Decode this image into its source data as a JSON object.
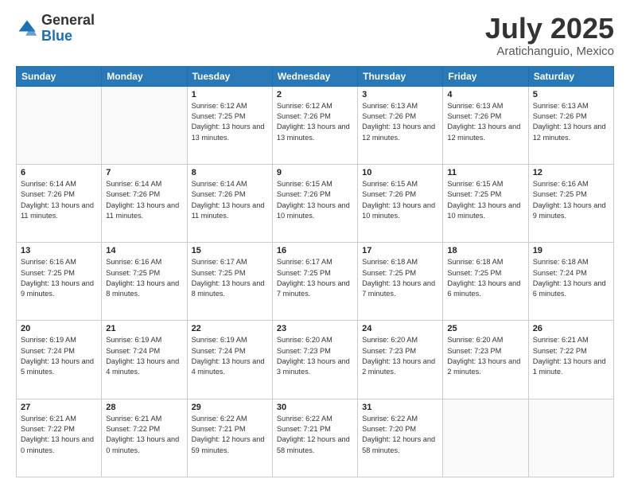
{
  "header": {
    "logo": {
      "general": "General",
      "blue": "Blue"
    },
    "month": "July 2025",
    "location": "Aratichanguio, Mexico"
  },
  "days_of_week": [
    "Sunday",
    "Monday",
    "Tuesday",
    "Wednesday",
    "Thursday",
    "Friday",
    "Saturday"
  ],
  "weeks": [
    [
      {
        "day": "",
        "sunrise": "",
        "sunset": "",
        "daylight": ""
      },
      {
        "day": "",
        "sunrise": "",
        "sunset": "",
        "daylight": ""
      },
      {
        "day": "1",
        "sunrise": "Sunrise: 6:12 AM",
        "sunset": "Sunset: 7:25 PM",
        "daylight": "Daylight: 13 hours and 13 minutes."
      },
      {
        "day": "2",
        "sunrise": "Sunrise: 6:12 AM",
        "sunset": "Sunset: 7:26 PM",
        "daylight": "Daylight: 13 hours and 13 minutes."
      },
      {
        "day": "3",
        "sunrise": "Sunrise: 6:13 AM",
        "sunset": "Sunset: 7:26 PM",
        "daylight": "Daylight: 13 hours and 12 minutes."
      },
      {
        "day": "4",
        "sunrise": "Sunrise: 6:13 AM",
        "sunset": "Sunset: 7:26 PM",
        "daylight": "Daylight: 13 hours and 12 minutes."
      },
      {
        "day": "5",
        "sunrise": "Sunrise: 6:13 AM",
        "sunset": "Sunset: 7:26 PM",
        "daylight": "Daylight: 13 hours and 12 minutes."
      }
    ],
    [
      {
        "day": "6",
        "sunrise": "Sunrise: 6:14 AM",
        "sunset": "Sunset: 7:26 PM",
        "daylight": "Daylight: 13 hours and 11 minutes."
      },
      {
        "day": "7",
        "sunrise": "Sunrise: 6:14 AM",
        "sunset": "Sunset: 7:26 PM",
        "daylight": "Daylight: 13 hours and 11 minutes."
      },
      {
        "day": "8",
        "sunrise": "Sunrise: 6:14 AM",
        "sunset": "Sunset: 7:26 PM",
        "daylight": "Daylight: 13 hours and 11 minutes."
      },
      {
        "day": "9",
        "sunrise": "Sunrise: 6:15 AM",
        "sunset": "Sunset: 7:26 PM",
        "daylight": "Daylight: 13 hours and 10 minutes."
      },
      {
        "day": "10",
        "sunrise": "Sunrise: 6:15 AM",
        "sunset": "Sunset: 7:26 PM",
        "daylight": "Daylight: 13 hours and 10 minutes."
      },
      {
        "day": "11",
        "sunrise": "Sunrise: 6:15 AM",
        "sunset": "Sunset: 7:25 PM",
        "daylight": "Daylight: 13 hours and 10 minutes."
      },
      {
        "day": "12",
        "sunrise": "Sunrise: 6:16 AM",
        "sunset": "Sunset: 7:25 PM",
        "daylight": "Daylight: 13 hours and 9 minutes."
      }
    ],
    [
      {
        "day": "13",
        "sunrise": "Sunrise: 6:16 AM",
        "sunset": "Sunset: 7:25 PM",
        "daylight": "Daylight: 13 hours and 9 minutes."
      },
      {
        "day": "14",
        "sunrise": "Sunrise: 6:16 AM",
        "sunset": "Sunset: 7:25 PM",
        "daylight": "Daylight: 13 hours and 8 minutes."
      },
      {
        "day": "15",
        "sunrise": "Sunrise: 6:17 AM",
        "sunset": "Sunset: 7:25 PM",
        "daylight": "Daylight: 13 hours and 8 minutes."
      },
      {
        "day": "16",
        "sunrise": "Sunrise: 6:17 AM",
        "sunset": "Sunset: 7:25 PM",
        "daylight": "Daylight: 13 hours and 7 minutes."
      },
      {
        "day": "17",
        "sunrise": "Sunrise: 6:18 AM",
        "sunset": "Sunset: 7:25 PM",
        "daylight": "Daylight: 13 hours and 7 minutes."
      },
      {
        "day": "18",
        "sunrise": "Sunrise: 6:18 AM",
        "sunset": "Sunset: 7:25 PM",
        "daylight": "Daylight: 13 hours and 6 minutes."
      },
      {
        "day": "19",
        "sunrise": "Sunrise: 6:18 AM",
        "sunset": "Sunset: 7:24 PM",
        "daylight": "Daylight: 13 hours and 6 minutes."
      }
    ],
    [
      {
        "day": "20",
        "sunrise": "Sunrise: 6:19 AM",
        "sunset": "Sunset: 7:24 PM",
        "daylight": "Daylight: 13 hours and 5 minutes."
      },
      {
        "day": "21",
        "sunrise": "Sunrise: 6:19 AM",
        "sunset": "Sunset: 7:24 PM",
        "daylight": "Daylight: 13 hours and 4 minutes."
      },
      {
        "day": "22",
        "sunrise": "Sunrise: 6:19 AM",
        "sunset": "Sunset: 7:24 PM",
        "daylight": "Daylight: 13 hours and 4 minutes."
      },
      {
        "day": "23",
        "sunrise": "Sunrise: 6:20 AM",
        "sunset": "Sunset: 7:23 PM",
        "daylight": "Daylight: 13 hours and 3 minutes."
      },
      {
        "day": "24",
        "sunrise": "Sunrise: 6:20 AM",
        "sunset": "Sunset: 7:23 PM",
        "daylight": "Daylight: 13 hours and 2 minutes."
      },
      {
        "day": "25",
        "sunrise": "Sunrise: 6:20 AM",
        "sunset": "Sunset: 7:23 PM",
        "daylight": "Daylight: 13 hours and 2 minutes."
      },
      {
        "day": "26",
        "sunrise": "Sunrise: 6:21 AM",
        "sunset": "Sunset: 7:22 PM",
        "daylight": "Daylight: 13 hours and 1 minute."
      }
    ],
    [
      {
        "day": "27",
        "sunrise": "Sunrise: 6:21 AM",
        "sunset": "Sunset: 7:22 PM",
        "daylight": "Daylight: 13 hours and 0 minutes."
      },
      {
        "day": "28",
        "sunrise": "Sunrise: 6:21 AM",
        "sunset": "Sunset: 7:22 PM",
        "daylight": "Daylight: 13 hours and 0 minutes."
      },
      {
        "day": "29",
        "sunrise": "Sunrise: 6:22 AM",
        "sunset": "Sunset: 7:21 PM",
        "daylight": "Daylight: 12 hours and 59 minutes."
      },
      {
        "day": "30",
        "sunrise": "Sunrise: 6:22 AM",
        "sunset": "Sunset: 7:21 PM",
        "daylight": "Daylight: 12 hours and 58 minutes."
      },
      {
        "day": "31",
        "sunrise": "Sunrise: 6:22 AM",
        "sunset": "Sunset: 7:20 PM",
        "daylight": "Daylight: 12 hours and 58 minutes."
      },
      {
        "day": "",
        "sunrise": "",
        "sunset": "",
        "daylight": ""
      },
      {
        "day": "",
        "sunrise": "",
        "sunset": "",
        "daylight": ""
      }
    ]
  ]
}
